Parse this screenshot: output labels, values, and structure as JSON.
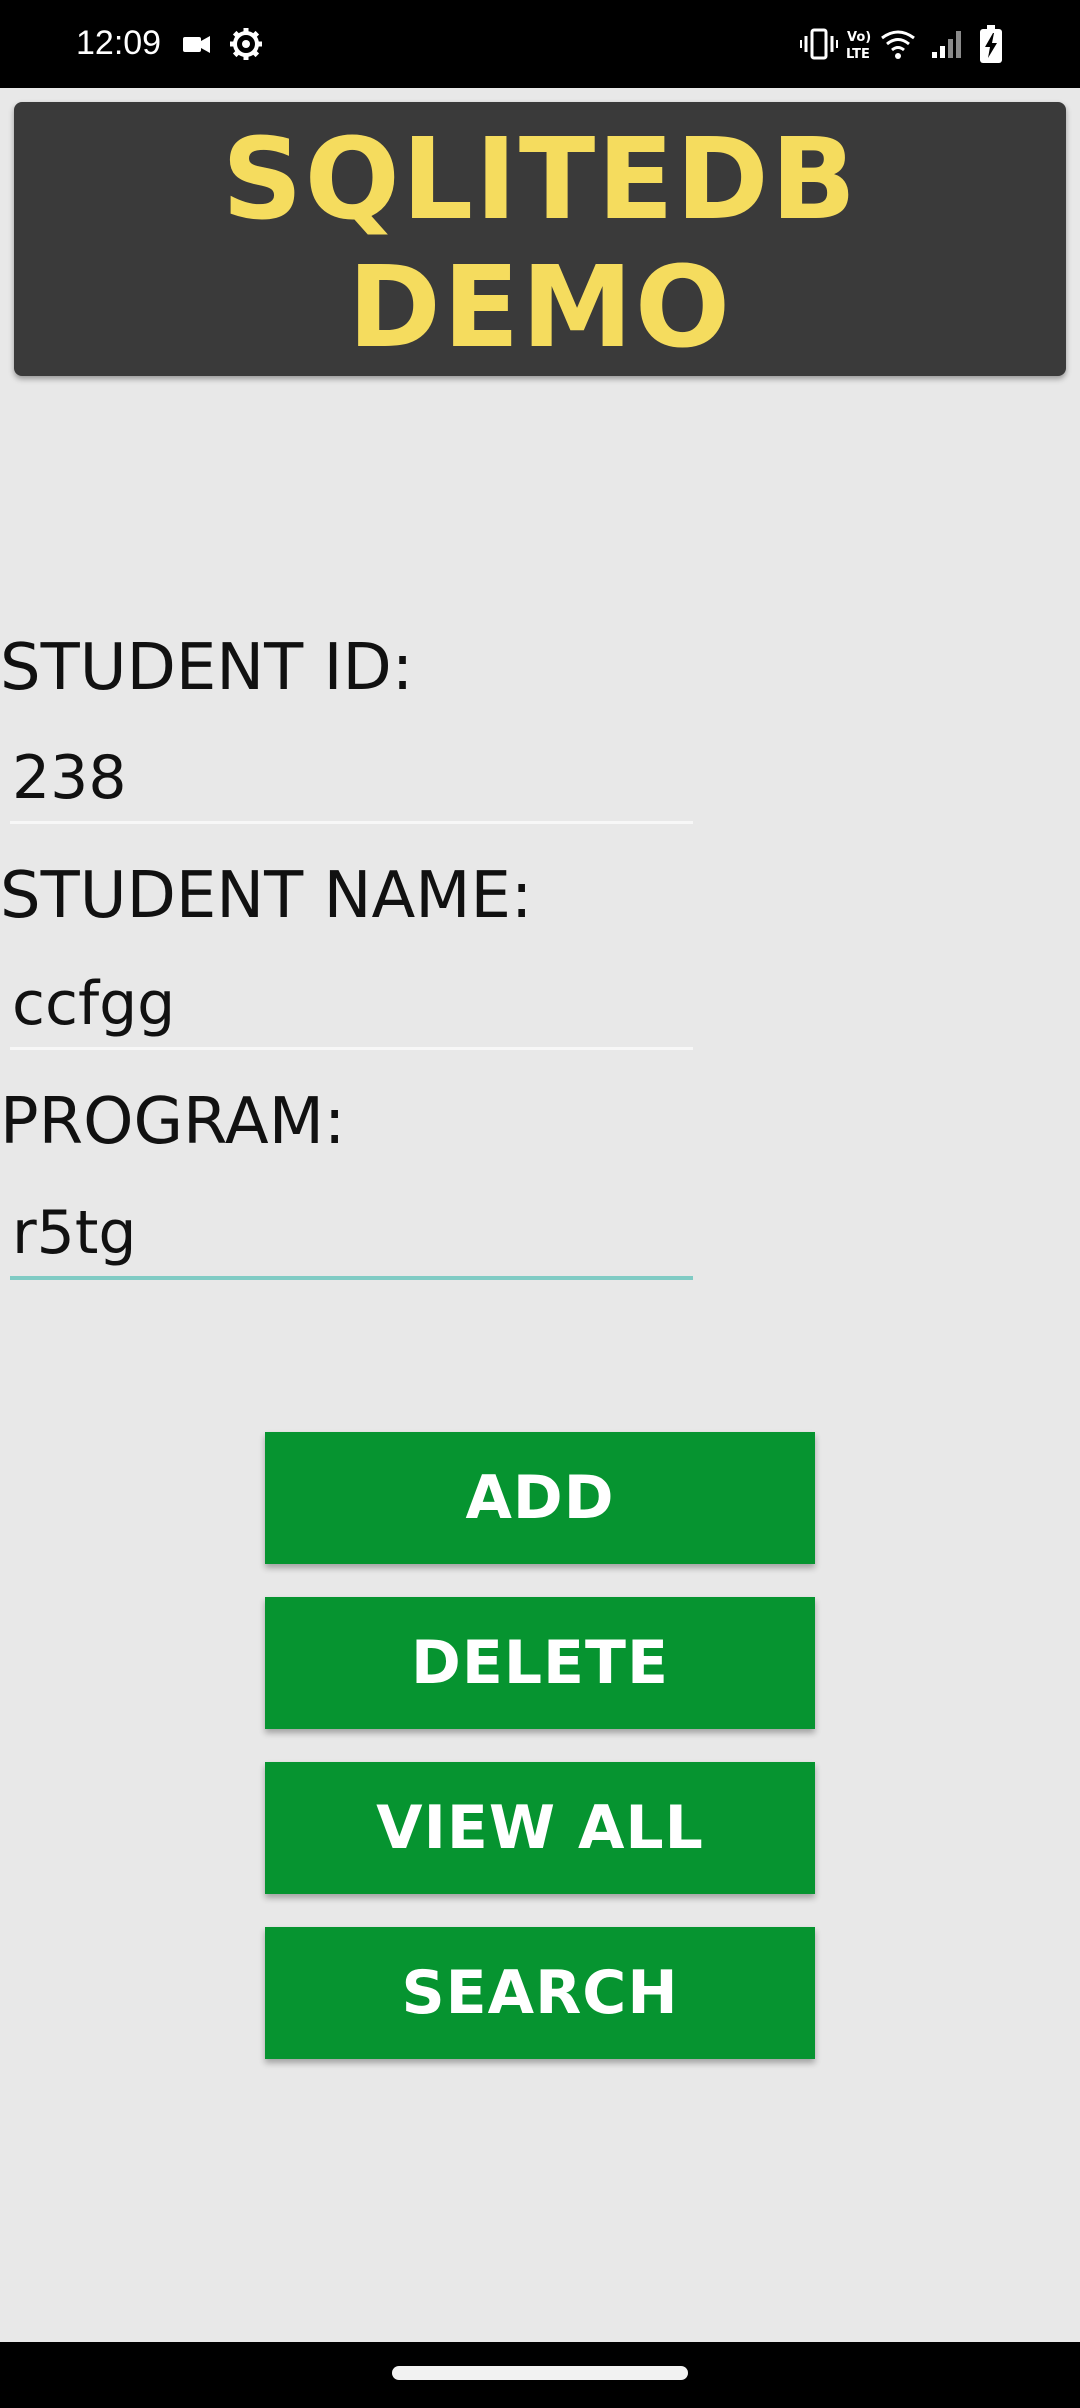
{
  "status_bar": {
    "time": "12:09",
    "left_icons": [
      "video-camera-icon",
      "settings-gear-icon"
    ],
    "right_icons": [
      "vibrate-icon",
      "volte-icon",
      "wifi-icon",
      "signal-icon",
      "battery-charging-icon"
    ],
    "volte_label": "Vo)\nLTE"
  },
  "header": {
    "title": "SQLITEDB\nDEMO",
    "background_color": "#3a3a3a",
    "title_color": "#f5dc5e"
  },
  "form": {
    "student_id": {
      "label": "STUDENT ID:",
      "value": "238"
    },
    "student_name": {
      "label": "STUDENT NAME:",
      "value": "ccfgg"
    },
    "program": {
      "label": "PROGRAM:",
      "value": "r5tg",
      "focused": true
    }
  },
  "buttons": {
    "add": "ADD",
    "delete": "DELETE",
    "view_all": "VIEW ALL",
    "search": "SEARCH",
    "color": "#069430"
  },
  "nav_bar": {
    "icons": [
      "home-handle"
    ]
  }
}
